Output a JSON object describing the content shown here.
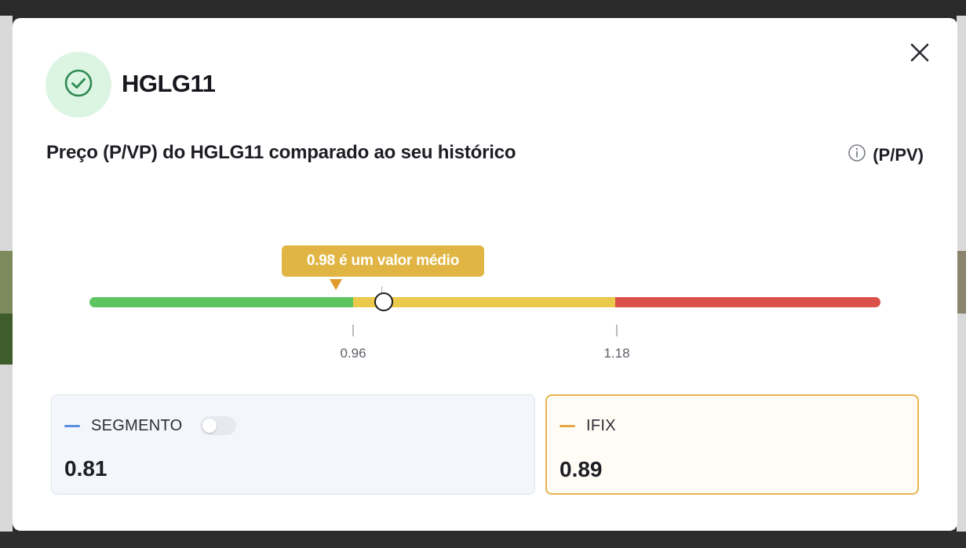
{
  "asset": {
    "ticker": "HGLG11",
    "status_icon": "check-circle-icon"
  },
  "section": {
    "title": "Preço (P/VP) do HGLG11 comparado ao seu histórico",
    "metric_label": "(P/PV)",
    "info_icon": "info-icon"
  },
  "gauge": {
    "tooltip": "0.98 é um valor médio",
    "current_value": 0.98,
    "thresholds": [
      {
        "label": "0.96",
        "value": 0.96
      },
      {
        "label": "1.18",
        "value": 1.18
      }
    ],
    "colors": {
      "low": "#5dc45f",
      "mid": "#ebc94a",
      "high": "#db5049",
      "tooltip": "#e0b544"
    }
  },
  "cards": {
    "segment": {
      "label": "SEGMENTO",
      "value": "0.81",
      "toggle_on": false,
      "color": "#5b8fe0"
    },
    "ifix": {
      "label": "IFIX",
      "value": "0.89",
      "color": "#e6a846"
    }
  }
}
